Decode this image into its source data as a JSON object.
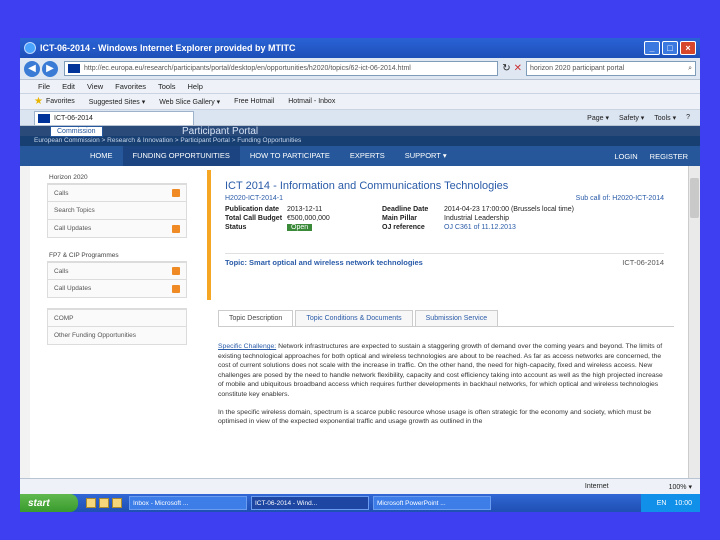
{
  "window": {
    "title": "ICT-06-2014 - Windows Internet Explorer provided by MTITC",
    "min": "_",
    "max": "□",
    "close": "×"
  },
  "address": {
    "url": "http://ec.europa.eu/research/participants/portal/desktop/en/opportunities/h2020/topics/62-ict-06-2014.html",
    "search": "horizon 2020 participant portal"
  },
  "menu": [
    "File",
    "Edit",
    "View",
    "Favorites",
    "Tools",
    "Help"
  ],
  "favorites": {
    "label": "Favorites",
    "items": [
      "Suggested Sites ▾",
      "Web Slice Gallery ▾",
      "Free Hotmail",
      "Hotmail - Inbox"
    ]
  },
  "tab": {
    "label": "ICT-06-2014"
  },
  "tabtools": [
    "Page ▾",
    "Safety ▾",
    "Tools ▾",
    "?"
  ],
  "portal": {
    "commission": "Commission",
    "title": "Participant Portal",
    "breadcrumb": "European Commission > Research & Innovation > Participant Portal > Funding Opportunities",
    "nav": [
      "HOME",
      "FUNDING OPPORTUNITIES",
      "HOW TO PARTICIPATE",
      "EXPERTS",
      "SUPPORT ▾"
    ],
    "login": "LOGIN",
    "register": "REGISTER"
  },
  "sidebar": {
    "group1_head": "Horizon 2020",
    "group1": [
      "Calls",
      "Search Topics",
      "Call Updates"
    ],
    "group2_head": "FP7 & CIP Programmes",
    "group2": [
      "Calls",
      "Call Updates"
    ],
    "group3": [
      "COMP",
      "Other Funding Opportunities"
    ]
  },
  "call": {
    "title": "ICT 2014 - Information and Communications Technologies",
    "id": "H2020-ICT-2014-1",
    "sub_call": "Sub call of: H2020-ICT-2014",
    "pub_label": "Publication date",
    "pub_value": "2013-12-11",
    "budget_label": "Total Call Budget",
    "budget_value": "€500,000,000",
    "status_label": "Status",
    "status_value": "Open",
    "deadline_label": "Deadline Date",
    "deadline_value": "2014-04-23 17:00:00 (Brussels local time)",
    "pillar_label": "Main Pillar",
    "pillar_value": "Industrial Leadership",
    "oj_label": "OJ reference",
    "oj_value": "OJ C361 of 11.12.2013",
    "topic": "Topic: Smart optical and wireless network technologies",
    "topic_id": "ICT-06-2014"
  },
  "content_tabs": [
    "Topic Description",
    "Topic Conditions & Documents",
    "Submission Service"
  ],
  "body": {
    "p1_lead": "Specific Challenge:",
    "p1": " Network infrastructures are expected to sustain a staggering growth of demand over the coming years and beyond. The limits of existing technological approaches for both optical and wireless technologies are about to be reached. As far as access networks are concerned, the cost of current solutions does not scale with the increase in traffic. On the other hand, the need for high-capacity, fixed and wireless access. New challenges are posed by the need to handle network flexibility, capacity and cost efficiency taking into account as well as the high projected increase of mobile and ubiquitous broadband access which requires further developments in backhaul networks, for which optical and wireless technologies constitute key enablers.",
    "p2": "In the specific wireless domain, spectrum is a scarce public resource whose usage is often strategic for the economy and society, which must be optimised in view of the expected exponential traffic and usage growth as outlined in the"
  },
  "status": {
    "zone": "Internet",
    "zoom": "100% ▾"
  },
  "taskbar": {
    "start": "start",
    "tasks": [
      "Inbox - Microsoft ...",
      "ICT-06-2014 - Wind...",
      "Microsoft PowerPoint ..."
    ],
    "lang": "EN",
    "clock": "10:00"
  }
}
